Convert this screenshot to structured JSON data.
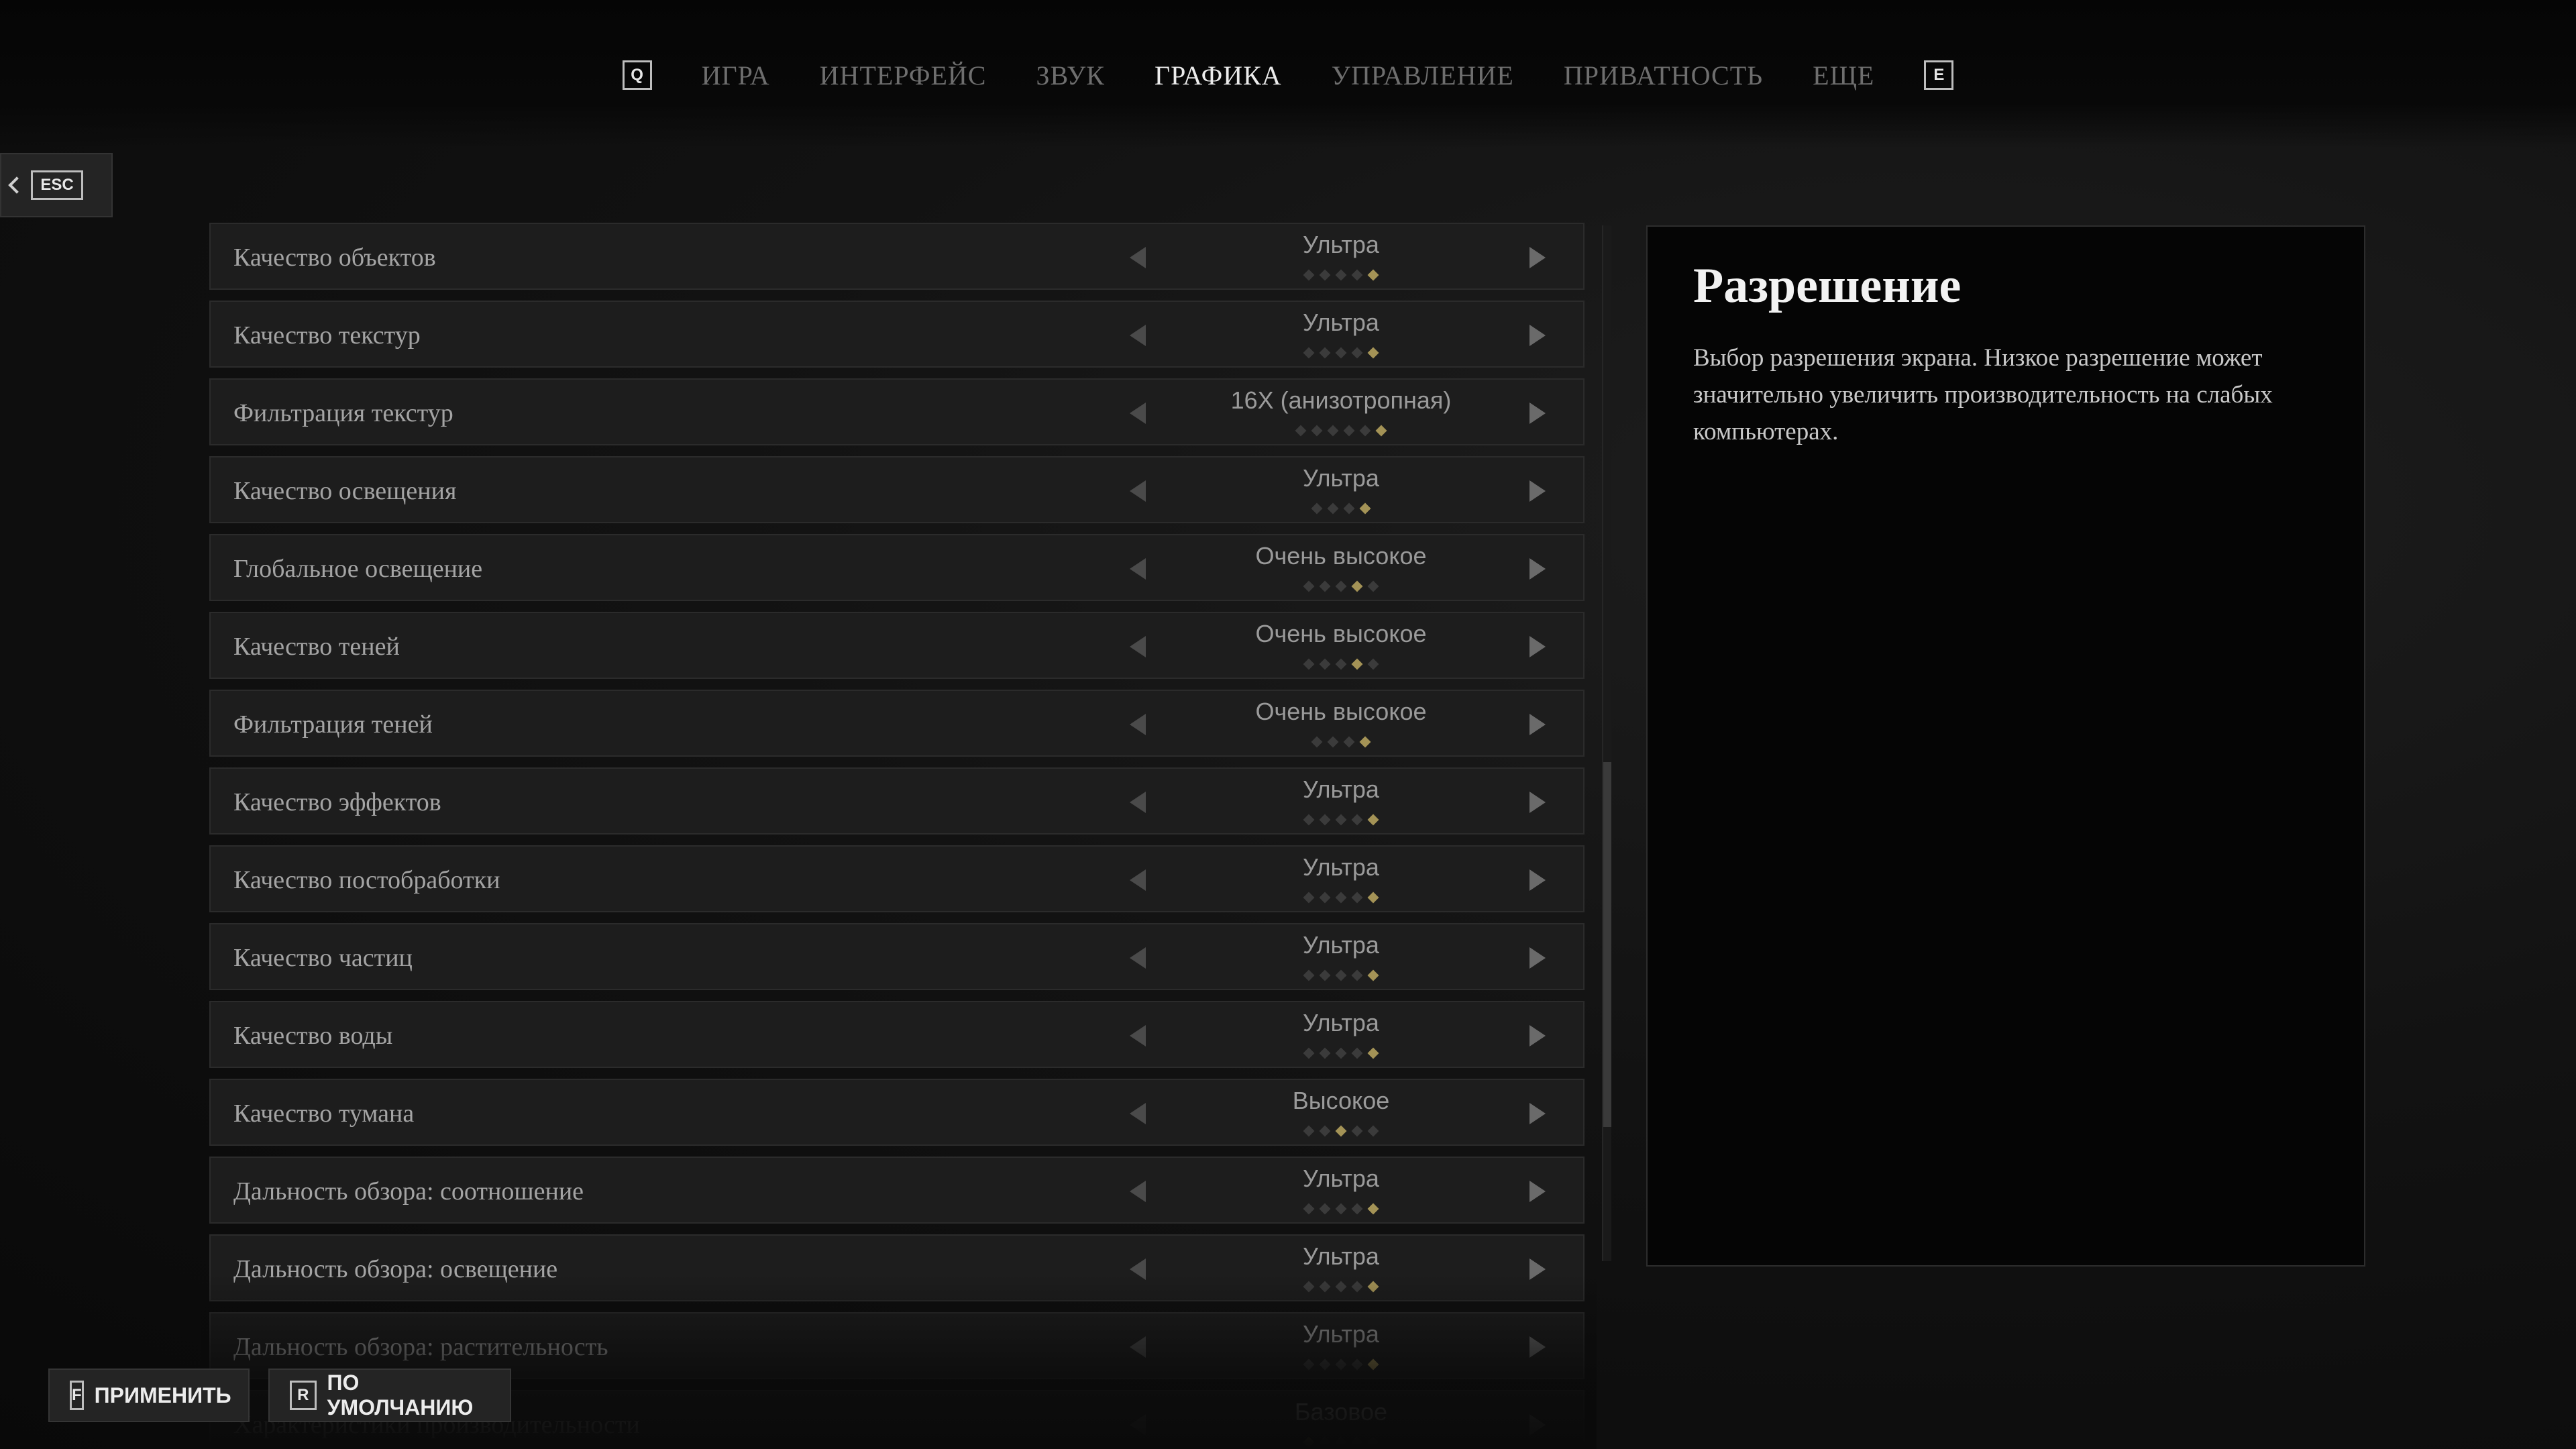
{
  "nav": {
    "prev_key": "Q",
    "next_key": "E",
    "tabs": [
      {
        "label": "ИГРА"
      },
      {
        "label": "ИНТЕРФЕЙС"
      },
      {
        "label": "ЗВУК"
      },
      {
        "label": "ГРАФИКА"
      },
      {
        "label": "УПРАВЛЕНИЕ"
      },
      {
        "label": "ПРИВАТНОСТЬ"
      },
      {
        "label": "ЕЩЕ"
      }
    ],
    "active_tab": "ГРАФИКА"
  },
  "back": {
    "key": "ESC"
  },
  "settings": [
    {
      "label": "Качество объектов",
      "value": "Ультра",
      "level": 5,
      "steps": 5
    },
    {
      "label": "Качество текстур",
      "value": "Ультра",
      "level": 5,
      "steps": 5
    },
    {
      "label": "Фильтрация текстур",
      "value": "16X (анизотропная)",
      "level": 6,
      "steps": 6
    },
    {
      "label": "Качество освещения",
      "value": "Ультра",
      "level": 4,
      "steps": 4
    },
    {
      "label": "Глобальное освещение",
      "value": "Очень высокое",
      "level": 4,
      "steps": 5
    },
    {
      "label": "Качество теней",
      "value": "Очень высокое",
      "level": 4,
      "steps": 5
    },
    {
      "label": "Фильтрация теней",
      "value": "Очень высокое",
      "level": 4,
      "steps": 4
    },
    {
      "label": "Качество эффектов",
      "value": "Ультра",
      "level": 5,
      "steps": 5
    },
    {
      "label": "Качество постобработки",
      "value": "Ультра",
      "level": 5,
      "steps": 5
    },
    {
      "label": "Качество частиц",
      "value": "Ультра",
      "level": 5,
      "steps": 5
    },
    {
      "label": "Качество воды",
      "value": "Ультра",
      "level": 5,
      "steps": 5
    },
    {
      "label": "Качество тумана",
      "value": "Высокое",
      "level": 3,
      "steps": 5
    },
    {
      "label": "Дальность обзора: соотношение",
      "value": "Ультра",
      "level": 5,
      "steps": 5
    },
    {
      "label": "Дальность обзора: освещение",
      "value": "Ультра",
      "level": 5,
      "steps": 5
    },
    {
      "label": "Дальность обзора: растительность",
      "value": "Ультра",
      "level": 5,
      "steps": 5
    },
    {
      "label": "Характеристики производительности",
      "value": "Базовое",
      "level": 1,
      "steps": 5
    }
  ],
  "info_panel": {
    "title": "Разрешение",
    "description": "Выбор разрешения экрана. Низкое разрешение может значительно увеличить производительность на слабых компьютерах."
  },
  "footer": {
    "apply_key": "F",
    "apply_label": "ПРИМЕНИТЬ",
    "default_key": "R",
    "default_label": "ПО УМОЛЧАНИЮ"
  },
  "colors": {
    "accent_dot": "#a49356",
    "inactive_dot": "#3b3b3b"
  }
}
